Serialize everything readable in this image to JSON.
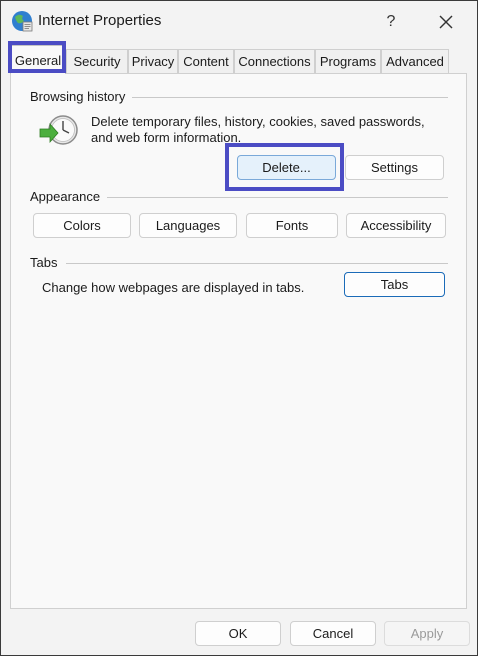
{
  "window": {
    "title": "Internet Properties",
    "help_label": "?"
  },
  "tabs": [
    {
      "label": "General",
      "active": true
    },
    {
      "label": "Security"
    },
    {
      "label": "Privacy"
    },
    {
      "label": "Content"
    },
    {
      "label": "Connections"
    },
    {
      "label": "Programs"
    },
    {
      "label": "Advanced"
    }
  ],
  "browsing_history": {
    "heading": "Browsing history",
    "description_line1": "Delete temporary files, history, cookies, saved passwords,",
    "description_line2": "and web form information.",
    "delete_label": "Delete...",
    "settings_label": "Settings"
  },
  "appearance": {
    "heading": "Appearance",
    "colors_label": "Colors",
    "languages_label": "Languages",
    "fonts_label": "Fonts",
    "accessibility_label": "Accessibility"
  },
  "tabs_section": {
    "heading": "Tabs",
    "description": "Change how webpages are displayed in tabs.",
    "tabs_label": "Tabs"
  },
  "footer": {
    "ok_label": "OK",
    "cancel_label": "Cancel",
    "apply_label": "Apply"
  },
  "colors": {
    "highlight": "#4b4cc4",
    "accent": "#0067c0"
  }
}
